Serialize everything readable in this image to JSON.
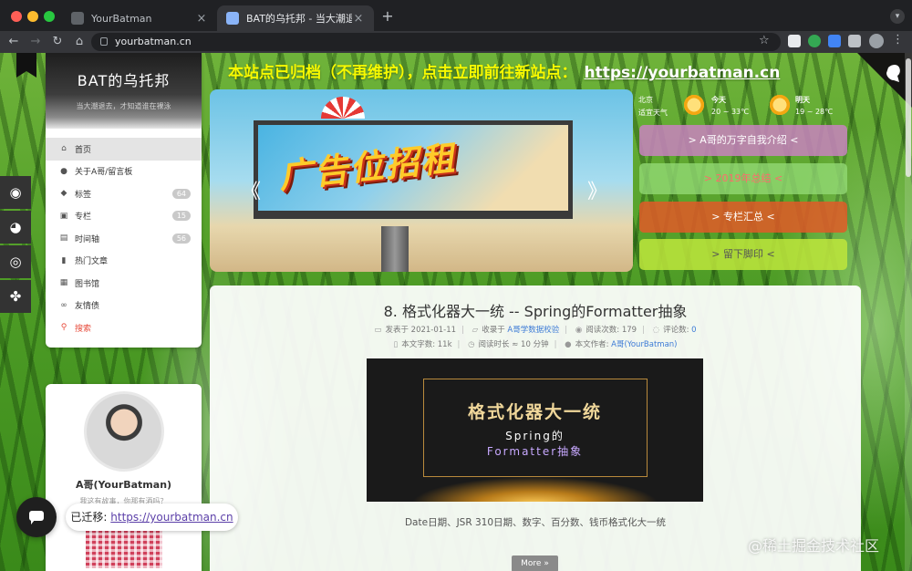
{
  "browser": {
    "tabs": [
      {
        "title": "YourBatman"
      },
      {
        "title": "BAT的乌托邦 - 当大潮退去，才知道谁在裸泳"
      }
    ],
    "url": "yourbatman.cn",
    "icons": [
      "back-icon",
      "forward-icon",
      "reload-icon",
      "home-icon",
      "lock-icon",
      "star-icon",
      "extension-icon",
      "menu-icon"
    ]
  },
  "nav": {
    "brand_title": "BAT的乌托邦",
    "brand_sub": "当大潮退去，才知道谁在裸泳",
    "items": [
      {
        "icon": "⌂",
        "label": "首页",
        "badge": ""
      },
      {
        "icon": "●",
        "label": "关于A哥/留言板",
        "badge": ""
      },
      {
        "icon": "◆",
        "label": "标签",
        "badge": "64"
      },
      {
        "icon": "▣",
        "label": "专栏",
        "badge": "15"
      },
      {
        "icon": "▤",
        "label": "时间轴",
        "badge": "56"
      },
      {
        "icon": "▮",
        "label": "热门文章",
        "badge": ""
      },
      {
        "icon": "▦",
        "label": "图书馆",
        "badge": ""
      },
      {
        "icon": "∞",
        "label": "友情债",
        "badge": ""
      },
      {
        "icon": "⚲",
        "label": "搜索",
        "badge": ""
      }
    ]
  },
  "social": [
    {
      "icon": "◉",
      "name": "wechat-icon"
    },
    {
      "icon": "◕",
      "name": "qq-icon"
    },
    {
      "icon": "◎",
      "name": "weibo-icon"
    },
    {
      "icon": "✤",
      "name": "paw-icon"
    }
  ],
  "profile": {
    "name": "A哥(YourBatman)",
    "bio": "我这有故事，你那有酒吗？"
  },
  "notice": {
    "text": "本站点已归档（不再维护），点击立即前往新站点：",
    "link": "https://yourbatman.cn"
  },
  "slider": {
    "billboard_text": "广告位招租",
    "prev": "《",
    "next": "》"
  },
  "weather": {
    "city": "北京",
    "air": "适宜天气",
    "today_label": "今天",
    "today_temp": "20 ~ 33℃",
    "tomorrow_label": "明天",
    "tomorrow_temp": "19 ~ 28℃"
  },
  "quick_links": [
    {
      "label": "> A哥的万字自我介绍 <"
    },
    {
      "label": "> 2019年总结 <"
    },
    {
      "label": "> 专栏汇总 <"
    },
    {
      "label": "> 留下脚印 <"
    }
  ],
  "post": {
    "title": "8. 格式化器大一统 -- Spring的Formatter抽象",
    "published_label": "发表于",
    "published": "2021-01-11",
    "category_label": "收录于",
    "category": "A哥学数据校验",
    "views_label": "阅读次数:",
    "views": "179",
    "comments_label": "评论数:",
    "comments": "0",
    "words_label": "本文字数:",
    "words": "11k",
    "duration_label": "阅读时长 ≈",
    "duration": "10 分钟",
    "author_label": "本文作者:",
    "author": "A哥(YourBatman)",
    "thumb_title": "格式化器大一统",
    "thumb_sub1": "Spring的",
    "thumb_sub2": "Formatter抽象",
    "excerpt": "Date日期、JSR 310日期、数字、百分数、钱币格式化大一统",
    "more": "More »"
  },
  "migrate": {
    "label": "已迁移:",
    "link": "https://yourbatman.cn"
  },
  "watermark": "@稀土掘金技术社区"
}
